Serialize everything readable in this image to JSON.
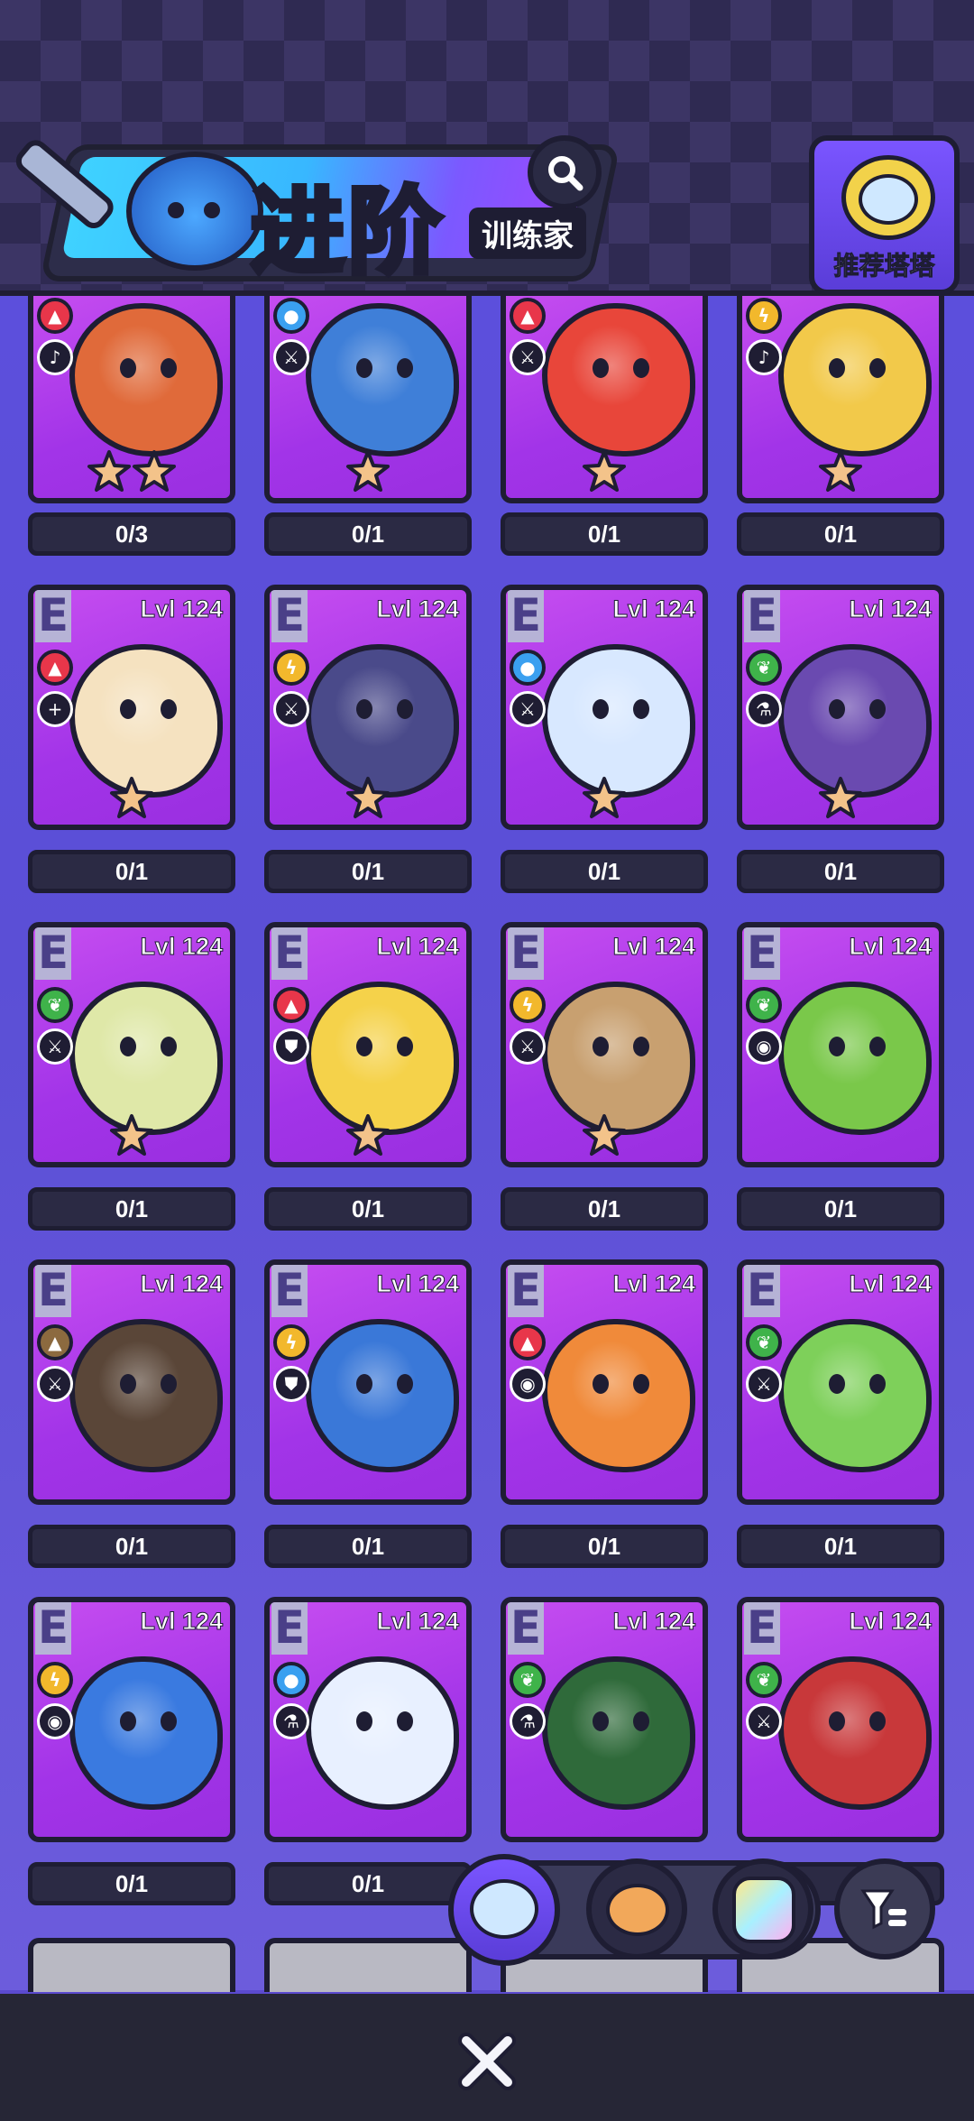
{
  "header": {
    "title": "进阶",
    "subtitle": "训练家",
    "recommend_label": "推荐塔塔"
  },
  "colors": {
    "fire": "#e8364a",
    "water": "#3aa0f0",
    "electric": "#f2b82c",
    "grass": "#3fb34a",
    "earth": "#8c6a3f",
    "card": "#b43ef0",
    "background": "#5b4fd6"
  },
  "cards": [
    {
      "rank": "",
      "level": "",
      "element": "fire",
      "element_icon": "flame-icon",
      "role": "bell-icon",
      "stars": 2,
      "count": "0/3",
      "tint": "#e06a3a"
    },
    {
      "rank": "",
      "level": "",
      "element": "water",
      "element_icon": "drop-icon",
      "role": "sword-icon",
      "stars": 1,
      "count": "0/1",
      "tint": "#3f7fd8"
    },
    {
      "rank": "",
      "level": "",
      "element": "fire",
      "element_icon": "flame-icon",
      "role": "sword-icon",
      "stars": 1,
      "count": "0/1",
      "tint": "#e8463a"
    },
    {
      "rank": "",
      "level": "",
      "element": "electric",
      "element_icon": "bolt-icon",
      "role": "bell-icon",
      "stars": 1,
      "count": "0/1",
      "tint": "#f2c94a"
    },
    {
      "rank": "E",
      "level": "Lvl 124",
      "element": "fire",
      "element_icon": "flame-icon",
      "role": "plus-icon",
      "stars": 1,
      "count": "0/1",
      "tint": "#f5e2c0"
    },
    {
      "rank": "E",
      "level": "Lvl 124",
      "element": "electric",
      "element_icon": "bolt-icon",
      "role": "sword-icon",
      "stars": 1,
      "count": "0/1",
      "tint": "#4a4a8a"
    },
    {
      "rank": "E",
      "level": "Lvl 124",
      "element": "water",
      "element_icon": "drop-icon",
      "role": "sword-icon",
      "stars": 1,
      "count": "0/1",
      "tint": "#d8e8ff"
    },
    {
      "rank": "E",
      "level": "Lvl 124",
      "element": "grass",
      "element_icon": "leaf-icon",
      "role": "flask-icon",
      "stars": 1,
      "count": "0/1",
      "tint": "#6a4ab0"
    },
    {
      "rank": "E",
      "level": "Lvl 124",
      "element": "grass",
      "element_icon": "leaf-icon",
      "role": "sword-icon",
      "stars": 1,
      "count": "0/1",
      "tint": "#dfe8a8"
    },
    {
      "rank": "E",
      "level": "Lvl 124",
      "element": "fire",
      "element_icon": "flame-icon",
      "role": "shield-icon",
      "stars": 1,
      "count": "0/1",
      "tint": "#f5d24a"
    },
    {
      "rank": "E",
      "level": "Lvl 124",
      "element": "electric",
      "element_icon": "bolt-icon",
      "role": "sword-icon",
      "stars": 1,
      "count": "0/1",
      "tint": "#c8a070"
    },
    {
      "rank": "E",
      "level": "Lvl 124",
      "element": "grass",
      "element_icon": "leaf-icon",
      "role": "eye-icon",
      "stars": 0,
      "count": "0/1",
      "tint": "#7ac84a"
    },
    {
      "rank": "E",
      "level": "Lvl 124",
      "element": "earth",
      "element_icon": "mountain-icon",
      "role": "sword-icon",
      "stars": 0,
      "count": "0/1",
      "tint": "#5a4638"
    },
    {
      "rank": "E",
      "level": "Lvl 124",
      "element": "electric",
      "element_icon": "bolt-icon",
      "role": "shield-icon",
      "stars": 0,
      "count": "0/1",
      "tint": "#3a78d8"
    },
    {
      "rank": "E",
      "level": "Lvl 124",
      "element": "fire",
      "element_icon": "flame-icon",
      "role": "eye-icon",
      "stars": 0,
      "count": "0/1",
      "tint": "#f08a3a"
    },
    {
      "rank": "E",
      "level": "Lvl 124",
      "element": "grass",
      "element_icon": "leaf-icon",
      "role": "sword-icon",
      "stars": 0,
      "count": "0/1",
      "tint": "#7ed05a"
    },
    {
      "rank": "E",
      "level": "Lvl 124",
      "element": "electric",
      "element_icon": "bolt-icon",
      "role": "eye-icon",
      "stars": 0,
      "count": "0/1",
      "tint": "#3a7ae0"
    },
    {
      "rank": "E",
      "level": "Lvl 124",
      "element": "water",
      "element_icon": "drop-icon",
      "role": "flask-icon",
      "stars": 0,
      "count": "0/1",
      "tint": "#e8f0ff"
    },
    {
      "rank": "E",
      "level": "Lvl 124",
      "element": "grass",
      "element_icon": "leaf-icon",
      "role": "flask-icon",
      "stars": 0,
      "count": "",
      "tint": "#2f6a3a"
    },
    {
      "rank": "E",
      "level": "Lvl 124",
      "element": "grass",
      "element_icon": "leaf-icon",
      "role": "sword-icon",
      "stars": 0,
      "count": "",
      "tint": "#c8383a"
    }
  ],
  "partial_counts": [
    "0",
    ""
  ],
  "bottom": {
    "tabs": [
      "cat-robot-icon",
      "hamster-icon",
      "crystal-cat-icon"
    ],
    "filter_icon": "filter-icon",
    "close_icon": "close-icon"
  }
}
